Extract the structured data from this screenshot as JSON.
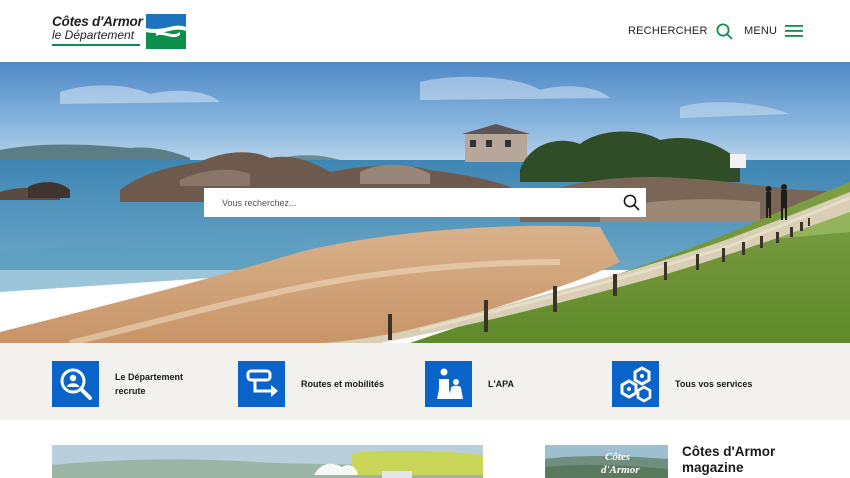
{
  "header": {
    "logo_line1": "Côtes d'Armor",
    "logo_line2": "le Département",
    "search_label": "RECHERCHER",
    "menu_label": "MENU"
  },
  "hero": {
    "search_placeholder": "Vous recherchez..."
  },
  "quicklinks": [
    {
      "label_line1": "Le Département",
      "label_line2": "recrute",
      "icon": "person-search-icon"
    },
    {
      "label_line1": "Routes et mobilités",
      "label_line2": "",
      "icon": "route-icon"
    },
    {
      "label_line1": "L'APA",
      "label_line2": "",
      "icon": "elderly-people-icon"
    },
    {
      "label_line1": "Tous vos services",
      "label_line2": "",
      "icon": "services-hexagon-icon"
    }
  ],
  "magazine": {
    "title": "Côtes d'Armor magazine",
    "thumb_text_line1": "Côtes",
    "thumb_text_line2": "d'Armor"
  },
  "colors": {
    "brand_green": "#0b8f4a",
    "brand_blue": "#0a63c9",
    "flag_blue": "#1e73be",
    "band_bg": "#f3f1ee"
  }
}
